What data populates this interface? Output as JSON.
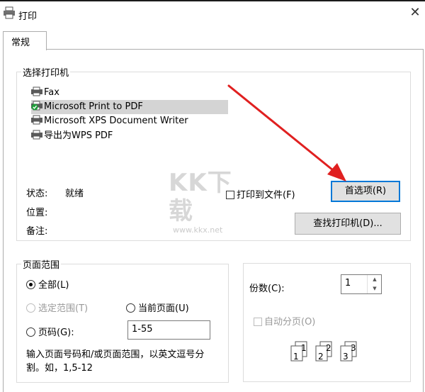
{
  "window": {
    "title": "打印"
  },
  "tabs": [
    {
      "label": "常规"
    }
  ],
  "select_printer": {
    "legend": "选择打印机",
    "printers": [
      {
        "name": "Fax",
        "icon": "fax-icon"
      },
      {
        "name": "Microsoft Print to PDF",
        "icon": "default-printer-icon",
        "selected": true
      },
      {
        "name": "Microsoft XPS Document Writer",
        "icon": "printer-icon"
      },
      {
        "name": "导出为WPS PDF",
        "icon": "printer-icon"
      }
    ],
    "status_label": "状态:",
    "status_value": "就绪",
    "location_label": "位置:",
    "comment_label": "备注:",
    "print_to_file": "打印到文件(F)",
    "preferences_button": "首选项(R)",
    "find_printer_button": "查找打印机(D)..."
  },
  "page_range": {
    "legend": "页面范围",
    "all": "全部(L)",
    "selection": "选定范围(T)",
    "current_page": "当前页面(U)",
    "pages": "页码(G):",
    "pages_value": "1-55",
    "hint": "输入页面号码和/或页面范围，以英文逗号分割。如，1,5-12"
  },
  "copies": {
    "label": "份数(C):",
    "value": "1",
    "collate": "自动分页(O)",
    "collate_pages": [
      "1",
      "1",
      "2",
      "2",
      "3",
      "3"
    ]
  },
  "watermark": {
    "text": "KK下载",
    "url": "www.kkx.net"
  },
  "colors": {
    "accent": "#0078d7",
    "arrow": "#e02020",
    "selection": "#d4d4d4"
  }
}
